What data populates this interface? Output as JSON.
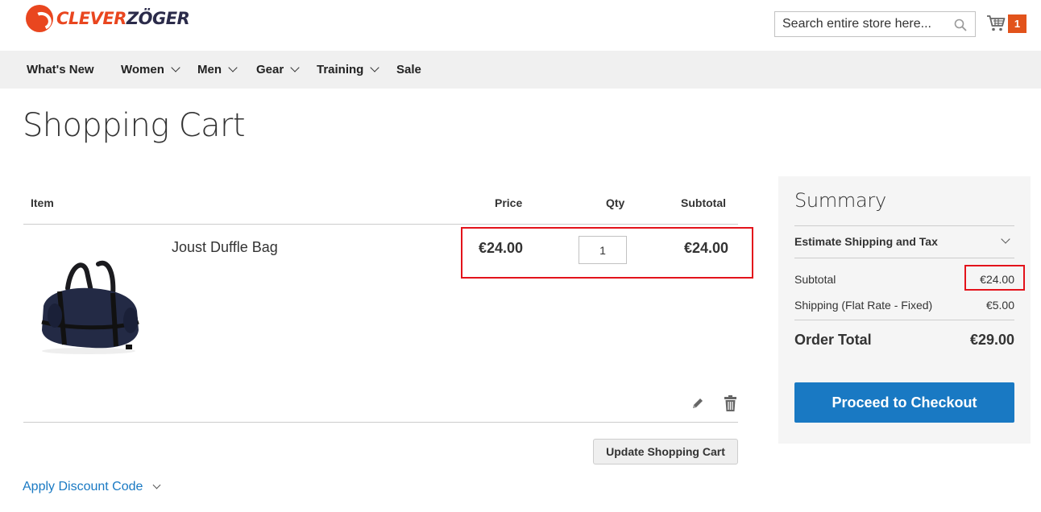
{
  "brand": {
    "logo_text_accent": "CLEVER",
    "logo_text_dark": "ZÖGER",
    "accent_color": "#e9461f"
  },
  "header": {
    "search_placeholder": "Search entire store here...",
    "cart_count": "1"
  },
  "nav": {
    "items": [
      {
        "label": "What's New",
        "has_dropdown": false
      },
      {
        "label": "Women",
        "has_dropdown": true
      },
      {
        "label": "Men",
        "has_dropdown": true
      },
      {
        "label": "Gear",
        "has_dropdown": true
      },
      {
        "label": "Training",
        "has_dropdown": true
      },
      {
        "label": "Sale",
        "has_dropdown": false
      }
    ]
  },
  "page": {
    "title": "Shopping Cart"
  },
  "cart": {
    "headers": {
      "item": "Item",
      "price": "Price",
      "qty": "Qty",
      "subtotal": "Subtotal"
    },
    "items": [
      {
        "name": "Joust Duffle Bag",
        "price": "€24.00",
        "qty": "1",
        "subtotal": "€24.00"
      }
    ],
    "update_label": "Update Shopping Cart",
    "discount_label": "Apply Discount Code"
  },
  "summary": {
    "title": "Summary",
    "estimate_label": "Estimate Shipping and Tax",
    "subtotal_label": "Subtotal",
    "subtotal_value": "€24.00",
    "shipping_label": "Shipping (Flat Rate - Fixed)",
    "shipping_value": "€5.00",
    "total_label": "Order Total",
    "total_value": "€29.00",
    "checkout_label": "Proceed to Checkout"
  },
  "colors": {
    "primary_button": "#1979c3",
    "highlight_border": "#e3131b",
    "badge": "#e2531b"
  }
}
